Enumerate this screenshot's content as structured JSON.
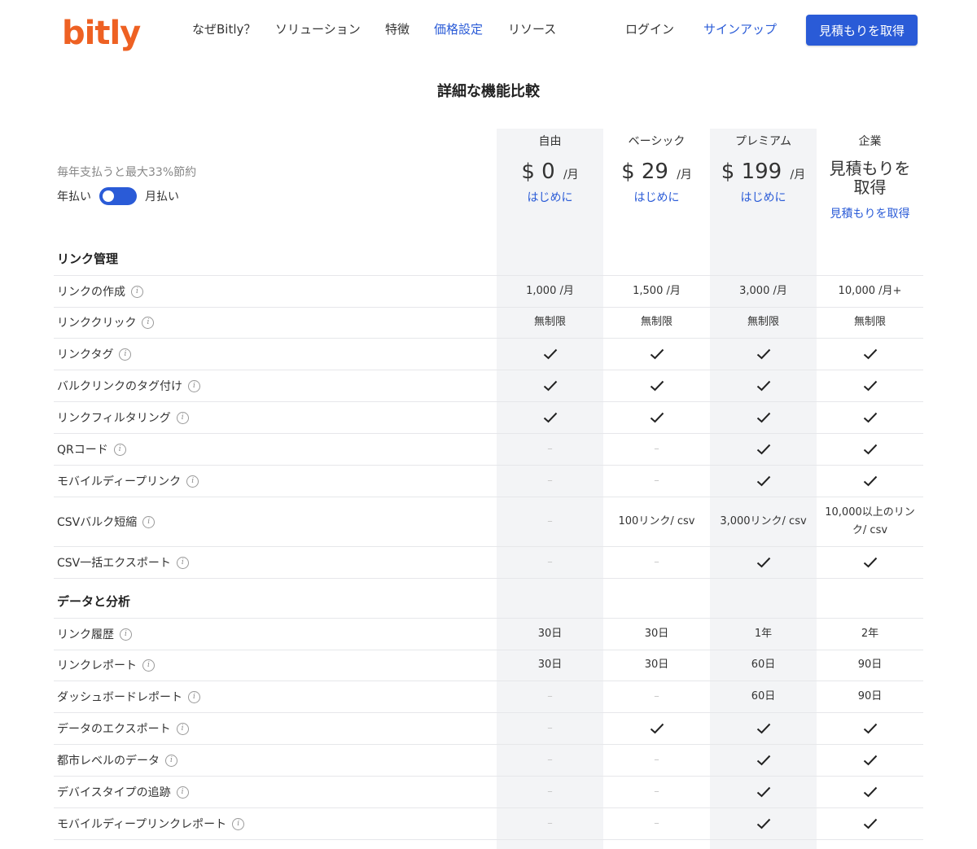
{
  "header": {
    "logo": "bitly",
    "nav": [
      "なぜBitly？",
      "ソリューション",
      "特徴",
      "価格設定",
      "リソース"
    ],
    "login": "ログイン",
    "signup": "サインアップ",
    "quote_button": "見積もりを取得"
  },
  "page_title": "詳細な機能比較",
  "billing": {
    "savings": "毎年支払うと最大33%節約",
    "annual": "年払い",
    "monthly": "月払い"
  },
  "plans": [
    {
      "name": "自由",
      "price": "$ 0",
      "unit": "/月",
      "cta": "はじめに"
    },
    {
      "name": "ベーシック",
      "price": "$ 29",
      "unit": "/月",
      "cta": "はじめに"
    },
    {
      "name": "プレミアム",
      "price": "$ 199",
      "unit": "/月",
      "cta": "はじめに"
    },
    {
      "name": "企業",
      "title_line1": "見積もりを",
      "title_line2": "取得",
      "cta": "見積もりを取得"
    }
  ],
  "groups": [
    {
      "title": "リンク管理",
      "rows": [
        {
          "label": "リンクの作成",
          "values": [
            "1,000 /月",
            "1,500 /月",
            "3,000 /月",
            "10,000 /月+"
          ]
        },
        {
          "label": "リンククリック",
          "values": [
            "無制限",
            "無制限",
            "無制限",
            "無制限"
          ]
        },
        {
          "label": "リンクタグ",
          "values": [
            "check",
            "check",
            "check",
            "check"
          ]
        },
        {
          "label": "バルクリンクのタグ付け",
          "values": [
            "check",
            "check",
            "check",
            "check"
          ]
        },
        {
          "label": "リンクフィルタリング",
          "values": [
            "check",
            "check",
            "check",
            "check"
          ]
        },
        {
          "label": "QRコード",
          "values": [
            "dash",
            "dash",
            "check",
            "check"
          ]
        },
        {
          "label": "モバイルディープリンク",
          "values": [
            "dash",
            "dash",
            "check",
            "check"
          ]
        },
        {
          "label": "CSVバルク短縮",
          "values": [
            "dash",
            "100リンク/ csv",
            "3,000リンク/ csv",
            "10,000以上のリンク/ csv"
          ]
        },
        {
          "label": "CSV一括エクスポート",
          "values": [
            "dash",
            "dash",
            "check",
            "check"
          ]
        }
      ]
    },
    {
      "title": "データと分析",
      "rows": [
        {
          "label": "リンク履歴",
          "values": [
            "30日",
            "30日",
            "1年",
            "2年"
          ]
        },
        {
          "label": "リンクレポート",
          "values": [
            "30日",
            "30日",
            "60日",
            "90日"
          ]
        },
        {
          "label": "ダッシュボードレポート",
          "values": [
            "dash",
            "dash",
            "60日",
            "90日"
          ]
        },
        {
          "label": "データのエクスポート",
          "values": [
            "dash",
            "check",
            "check",
            "check"
          ]
        },
        {
          "label": "都市レベルのデータ",
          "values": [
            "dash",
            "dash",
            "check",
            "check"
          ]
        },
        {
          "label": "デバイスタイプの追跡",
          "values": [
            "dash",
            "dash",
            "check",
            "check"
          ]
        },
        {
          "label": "モバイルディープリンクレポート",
          "values": [
            "dash",
            "dash",
            "check",
            "check"
          ]
        }
      ]
    }
  ]
}
